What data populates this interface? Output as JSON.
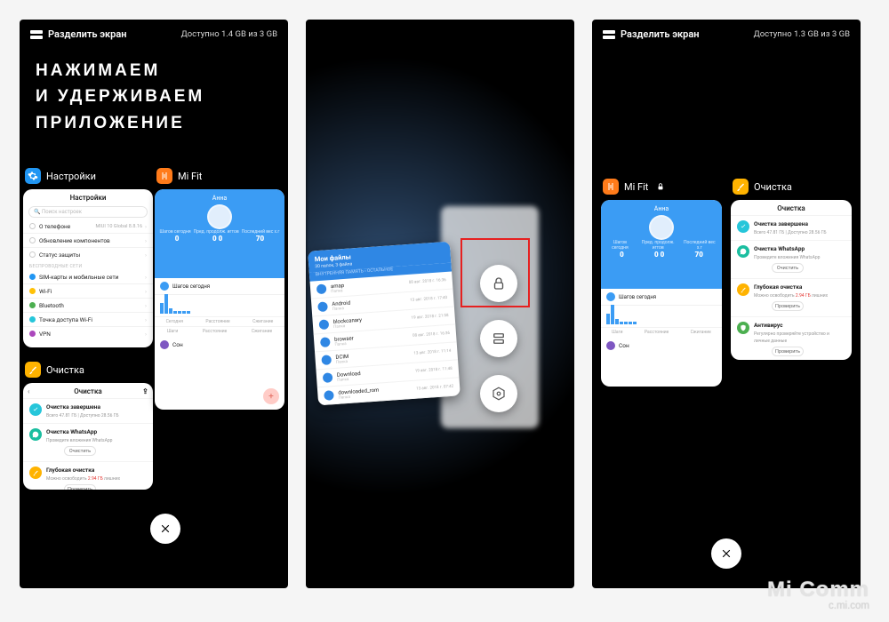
{
  "watermark": {
    "line1": "Mi Comm",
    "line2": "c.mi.com"
  },
  "panel1": {
    "split_label": "Разделить экран",
    "memory": "Доступно 1.4 GB из 3 GB",
    "headline_l1": "НАЖИМАЕМ",
    "headline_l2": "И УДЕРЖИВАЕМ",
    "headline_l3": "ПРИЛОЖЕНИЕ",
    "apps": {
      "settings": {
        "name": "Настройки",
        "title": "Настройки",
        "search_ph": "Поиск настроек",
        "rows": [
          {
            "label": "О телефоне",
            "value": "MIUI 10 Global 8.8.16"
          },
          {
            "label": "Обновление компонентов",
            "value": ""
          },
          {
            "label": "Статус защиты",
            "value": ""
          }
        ],
        "section": "БЕСПРОВОДНЫЕ СЕТИ",
        "rows2": [
          {
            "label": "SIM-карты и мобильные сети"
          },
          {
            "label": "Wi-Fi"
          },
          {
            "label": "Bluetooth"
          },
          {
            "label": "Точка доступа Wi-Fi"
          },
          {
            "label": "VPN"
          }
        ]
      },
      "mifit": {
        "name": "Mi Fit",
        "user": "Анна",
        "tab_labels": [
          "Шагов сегодня",
          "Пред. продолж. игтов",
          "Последний вес х.г"
        ],
        "tab_values": [
          "0",
          "0 0",
          "70"
        ],
        "steps_label": "Шагов сегодня",
        "mini": [
          "Шаги",
          "Расстояние",
          "Сжигание"
        ],
        "sleep": "Сон"
      },
      "cleaner": {
        "name": "Очистка",
        "title": "Очистка",
        "items": [
          {
            "title": "Очистка завершена",
            "sub": "Всего 47.81 ГБ | Доступно 28.56 ГБ",
            "color": "#26c6da",
            "svg": "check"
          },
          {
            "title": "Очистка WhatsApp",
            "sub": "Проведите вложения WhatsApp",
            "btn": "Очистить",
            "color": "#1bbea0",
            "svg": "wa"
          },
          {
            "title": "Глубокая очистка",
            "sub": "Можно освободить 2.94 ГБ лишних",
            "btn": "Проверить",
            "color": "#ffb300",
            "svg": "brush",
            "red": true
          }
        ]
      }
    }
  },
  "panel2": {
    "files": {
      "title": "Мои файлы",
      "sub": "30 папок, 3 файла",
      "crumb": "ВНУТРЕННЯЯ ПАМЯТЬ   ›   ОСТАЛЬНОЕ",
      "rows": [
        {
          "name": "amap",
          "sub": "Папка",
          "date": "08 авг. 2018 г. 16:36"
        },
        {
          "name": "Android",
          "sub": "Папка",
          "date": "13 авг. 2018 г. 17:40"
        },
        {
          "name": "blockcanary",
          "sub": "Папка",
          "date": "19 авг. 2018 г. 21:58"
        },
        {
          "name": "browser",
          "sub": "Папка",
          "date": "08 авг. 2018 г. 16:36"
        },
        {
          "name": "DCIM",
          "sub": "Папка",
          "date": "13 авг. 2018 г. 11:14"
        },
        {
          "name": "Download",
          "sub": "Папка",
          "date": "19 авг. 2018 г. 11:48"
        },
        {
          "name": "downloaded_rom",
          "sub": "Папка",
          "date": "13 авг. 2018 г. 07:42"
        }
      ]
    },
    "actions": [
      "lock",
      "split",
      "info"
    ]
  },
  "panel3": {
    "split_label": "Разделить экран",
    "memory": "Доступно 1.3 GB из 3 GB",
    "mifit_name": "Mi Fit",
    "cleaner": {
      "name": "Очистка",
      "title": "Очистка",
      "items": [
        {
          "title": "Очистка завершена",
          "sub": "Всего 47.81 ГБ | Доступно 28.56 ГБ",
          "color": "#26c6da",
          "svg": "check"
        },
        {
          "title": "Очистка WhatsApp",
          "sub": "Проведите вложения WhatsApp",
          "btn": "Очистить",
          "color": "#1bbea0",
          "svg": "wa"
        },
        {
          "title": "Глубокая очистка",
          "sub": "Можно освободить 2.94 ГБ лишних",
          "btn": "Проверить",
          "color": "#ffb300",
          "svg": "brush",
          "red": true
        },
        {
          "title": "Антивирус",
          "sub": "Регулярно проверяйте устройство и личные данные",
          "btn": "Проверить",
          "color": "#4caf50",
          "svg": "shield"
        }
      ]
    }
  }
}
